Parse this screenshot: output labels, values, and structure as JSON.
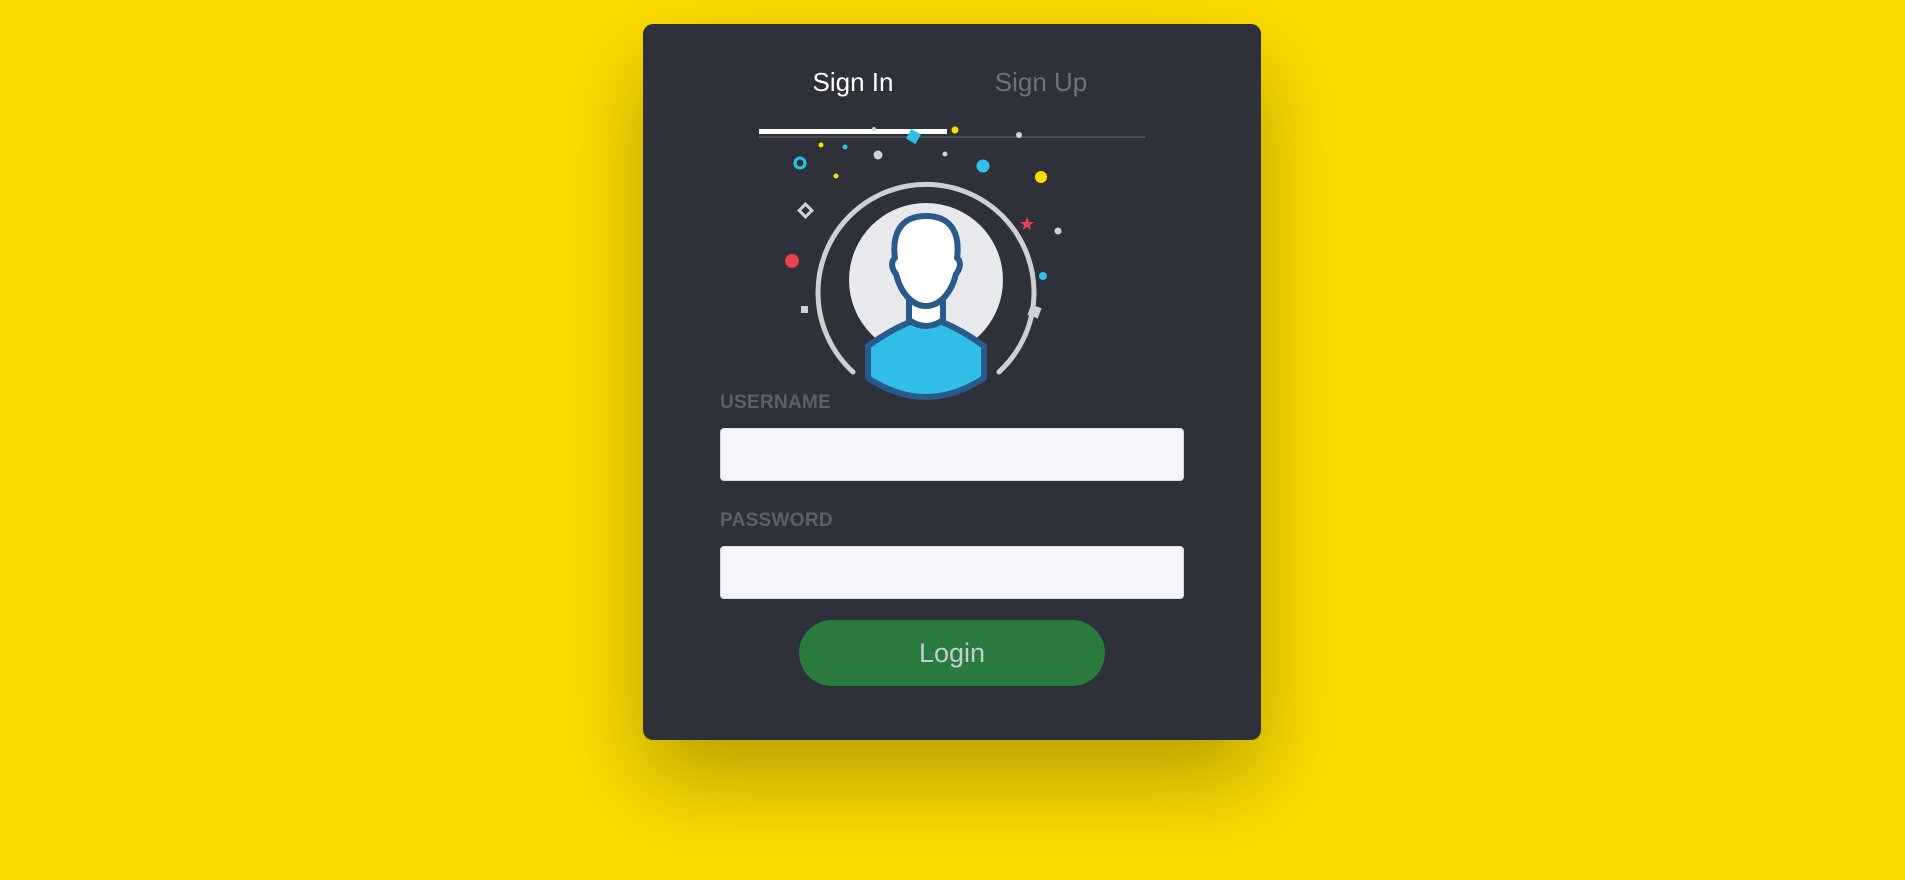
{
  "tabs": {
    "sign_in": "Sign In",
    "sign_up": "Sign Up"
  },
  "form": {
    "username_label": "USERNAME",
    "username_value": "",
    "password_label": "PASSWORD",
    "password_value": "",
    "login_label": "Login"
  },
  "colors": {
    "background": "#fcdc00",
    "card": "#2e3139",
    "login_button": "#287a3e",
    "avatar_body": "#2fbfe6",
    "avatar_outline": "#2a5a8c"
  },
  "icons": {
    "avatar": "user-avatar-icon"
  }
}
